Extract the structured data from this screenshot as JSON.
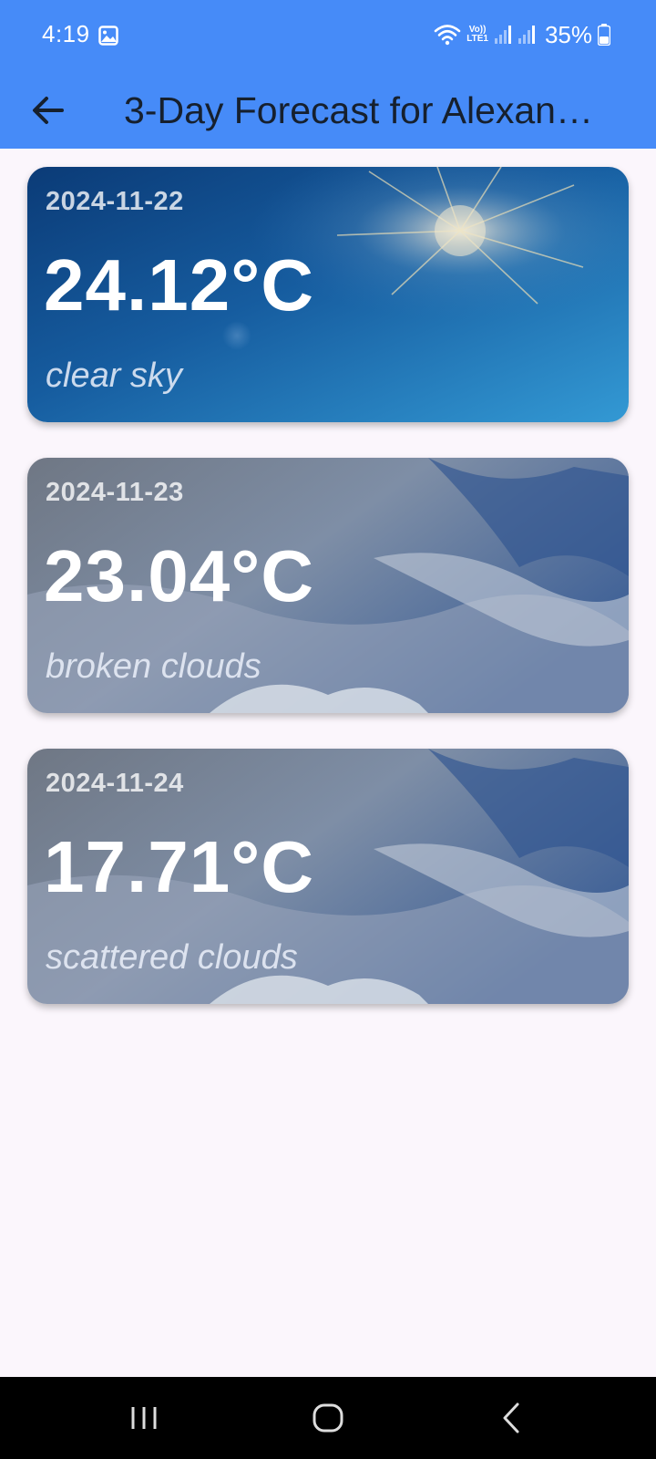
{
  "status_bar": {
    "time": "4:19",
    "volte_top": "Vo))",
    "volte_bottom": "LTE1",
    "battery": "35%",
    "icons": [
      "gallery-icon",
      "wifi-icon",
      "volte-icon",
      "signal-icon",
      "signal-icon",
      "battery-icon"
    ]
  },
  "app_bar": {
    "title": "3-Day Forecast for Alexan…",
    "back_icon": "arrow-left-icon",
    "color": "#468BF8"
  },
  "forecast": [
    {
      "date": "2024-11-22",
      "temp": "24.12°C",
      "description": "clear sky",
      "background": "sunny-sky"
    },
    {
      "date": "2024-11-23",
      "temp": "23.04°C",
      "description": "broken clouds",
      "background": "cloudy-sky"
    },
    {
      "date": "2024-11-24",
      "temp": "17.71°C",
      "description": "scattered clouds",
      "background": "cloudy-sky"
    }
  ],
  "nav_bar": {
    "icons": [
      "recent-apps-icon",
      "home-icon",
      "back-icon"
    ]
  }
}
